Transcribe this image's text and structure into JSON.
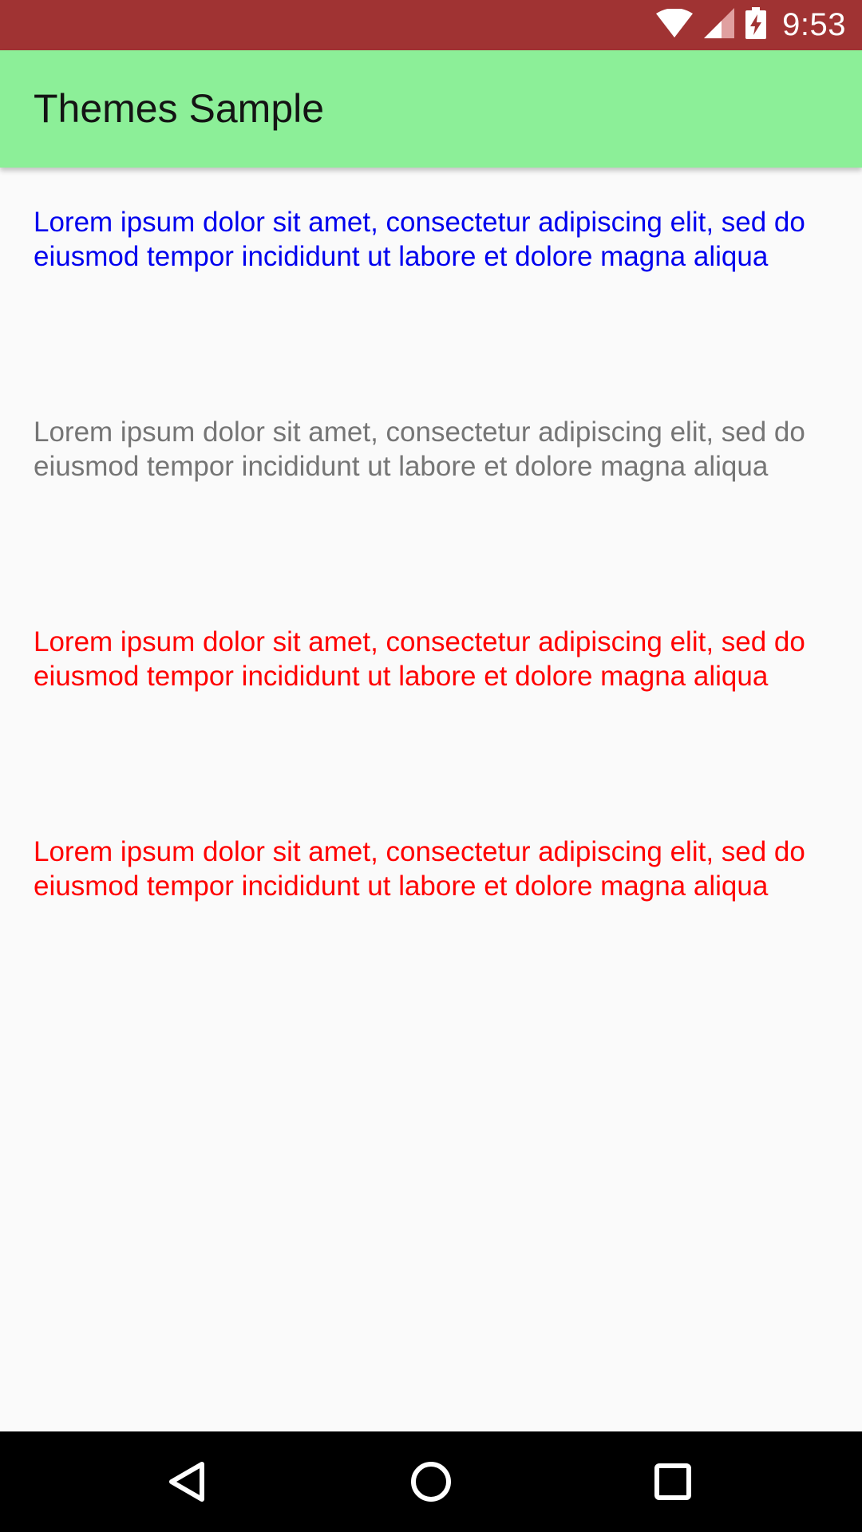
{
  "status_bar": {
    "time": "9:53",
    "icons": [
      "wifi-icon",
      "cell-signal-icon",
      "battery-charging-icon"
    ],
    "background": "#a03333"
  },
  "app_bar": {
    "title": "Themes Sample",
    "background": "#8cef98"
  },
  "paragraphs": [
    {
      "text": "Lorem ipsum dolor sit amet, consectetur adipiscing elit, sed do eiusmod tempor incididunt ut labore et dolore magna aliqua",
      "color": "#0000ee"
    },
    {
      "text": "Lorem ipsum dolor sit amet, consectetur adipiscing elit, sed do eiusmod tempor incididunt ut labore et dolore magna aliqua",
      "color": "#757575"
    },
    {
      "text": "Lorem ipsum dolor sit amet, consectetur adipiscing elit, sed do eiusmod tempor incididunt ut labore et dolore magna aliqua",
      "color": "#ff0000"
    },
    {
      "text": "Lorem ipsum dolor sit amet, consectetur adipiscing elit, sed do eiusmod tempor incididunt ut labore et dolore magna aliqua",
      "color": "#ff0000"
    }
  ],
  "nav_bar": {
    "buttons": [
      "back-icon",
      "home-icon",
      "recents-icon"
    ]
  }
}
